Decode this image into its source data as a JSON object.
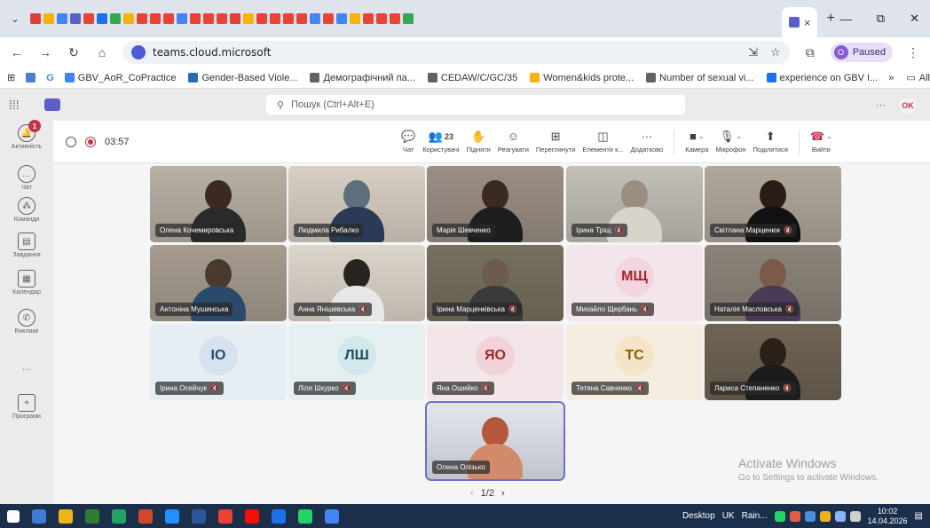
{
  "browser": {
    "tab_menu_label": "⌄",
    "tab_close": "×",
    "new_tab": "+",
    "window_controls": [
      "—",
      "⧉",
      "✕"
    ],
    "url": "teams.cloud.microsoft",
    "paused_label": "Paused",
    "paused_avatar": "O",
    "bookmarks": [
      {
        "label": "GBV_AoR_CoPractice",
        "color": "#4285f4"
      },
      {
        "label": "Gender-Based Viole...",
        "color": "#2b6cb0"
      },
      {
        "label": "Демографічний па...",
        "color": "#5f6368"
      },
      {
        "label": "CEDAW/C/GC/35",
        "color": "#5f6368"
      },
      {
        "label": "Women&kids prote...",
        "color": "#f4b400"
      },
      {
        "label": "Number of sexual vi...",
        "color": "#5f6368"
      },
      {
        "label": "experience on GBV I...",
        "color": "#1a73e8"
      }
    ],
    "bookmarks_more": "»",
    "all_bookmarks": "All Bookmarks"
  },
  "teams": {
    "search_placeholder": "Пошук (Ctrl+Alt+E)",
    "more": "···",
    "avatar_initials": "OK",
    "rail": [
      {
        "label": "Активність",
        "glyph": "🔔",
        "badge": "1"
      },
      {
        "label": "Чат",
        "glyph": "…"
      },
      {
        "label": "Команди",
        "glyph": "⁂"
      },
      {
        "label": "Завдання",
        "glyph": "▤"
      },
      {
        "label": "Календар",
        "glyph": "▦"
      },
      {
        "label": "Виклики",
        "glyph": "✆"
      },
      {
        "label": "",
        "glyph": "···"
      },
      {
        "label": "Програми",
        "glyph": "+"
      }
    ],
    "meeting": {
      "timer": "03:57",
      "participants_count": "23",
      "tools": [
        "Чат",
        "Користувачі",
        "Підняти",
        "Реагувати",
        "Переглянути",
        "Елементи к...",
        "Додатково",
        "Камера",
        "Мікрофон",
        "Поділитися",
        "Вийти"
      ]
    },
    "participants": [
      {
        "name": "Олена Кочемировська",
        "kind": "video",
        "muted": false,
        "bg": "#b9b0a4",
        "head": "#3a2a22",
        "shirt": "#2a2a2a"
      },
      {
        "name": "Людмила Рибалко",
        "kind": "video",
        "muted": false,
        "bg": "#d9cfc4",
        "head": "#5c6f7a",
        "shirt": "#2c3b55"
      },
      {
        "name": "Марія Шевченко",
        "kind": "video",
        "muted": false,
        "bg": "#9a8f86",
        "head": "#3b2a20",
        "shirt": "#1e1e1e"
      },
      {
        "name": "Ірина Тріщ",
        "kind": "video",
        "muted": true,
        "bg": "#c2bfb7",
        "head": "#9b8d80",
        "shirt": "#d9d4cb"
      },
      {
        "name": "Світлана Марценюк",
        "kind": "video",
        "muted": true,
        "bg": "#b1a89c",
        "head": "#2a1d18",
        "shirt": "#111111"
      },
      {
        "name": "Антоніна Мушинська",
        "kind": "video",
        "muted": false,
        "bg": "#a69d8f",
        "head": "#4a3a2e",
        "shirt": "#2b4a6b"
      },
      {
        "name": "Анна Янішевська",
        "kind": "video",
        "muted": true,
        "bg": "#ddd6cc",
        "head": "#2a2420",
        "shirt": "#e7e7e7"
      },
      {
        "name": "Ірина Марценківська",
        "kind": "video",
        "muted": true,
        "bg": "#77705f",
        "head": "#6d5b4c",
        "shirt": "#3a3a3a"
      },
      {
        "name": "Михайло Щербань",
        "kind": "initials",
        "initials": "МЩ",
        "muted": true,
        "bg": "#f2e6ec",
        "circle": "#f3d5df",
        "fg": "#a4262c"
      },
      {
        "name": "Наталія Масловська",
        "kind": "video",
        "muted": true,
        "bg": "#8c847a",
        "head": "#7a5a4a",
        "shirt": "#4a3a55"
      },
      {
        "name": "Ірина Осейчук",
        "kind": "initials",
        "initials": "ІО",
        "muted": true,
        "bg": "#e6eef3",
        "circle": "#d6e3ee",
        "fg": "#1b4a75"
      },
      {
        "name": "Ліля Шкурко",
        "kind": "initials",
        "initials": "ЛШ",
        "muted": true,
        "bg": "#e6f0f2",
        "circle": "#d3e8ec",
        "fg": "#174e5c"
      },
      {
        "name": "Яна Ошийко",
        "kind": "initials",
        "initials": "ЯО",
        "muted": true,
        "bg": "#f3e6e8",
        "circle": "#f2d3d7",
        "fg": "#a4262c"
      },
      {
        "name": "Тетяна Савченко",
        "kind": "initials",
        "initials": "ТС",
        "muted": true,
        "bg": "#f4ede0",
        "circle": "#f4e4c8",
        "fg": "#8a5a00"
      },
      {
        "name": "Лариса Степаненко",
        "kind": "video",
        "muted": true,
        "bg": "#6f6454",
        "head": "#2b2018",
        "shirt": "#1c1c1c"
      },
      {
        "name": "Олена Олізько",
        "kind": "video",
        "muted": false,
        "bg": "#e4e6ee",
        "head": "#b5573a",
        "shirt": "#d18b6a",
        "selected": true
      }
    ],
    "pager": "1/2",
    "watermark_title": "Activate Windows",
    "watermark_sub": "Go to Settings to activate Windows."
  },
  "taskbar": {
    "apps": [
      "#3d7bd9",
      "#f0b21a",
      "#2e7d32",
      "#21a366",
      "#d24726",
      "#1e90ff",
      "#2b579a",
      "#ea4335",
      "#f40f02",
      "#1a73e8",
      "#25d366",
      "#4285f4"
    ],
    "desktop_label": "Desktop",
    "lang": "UK",
    "weather": "Rain...",
    "time": "10:02",
    "date": "14.04.2026"
  }
}
